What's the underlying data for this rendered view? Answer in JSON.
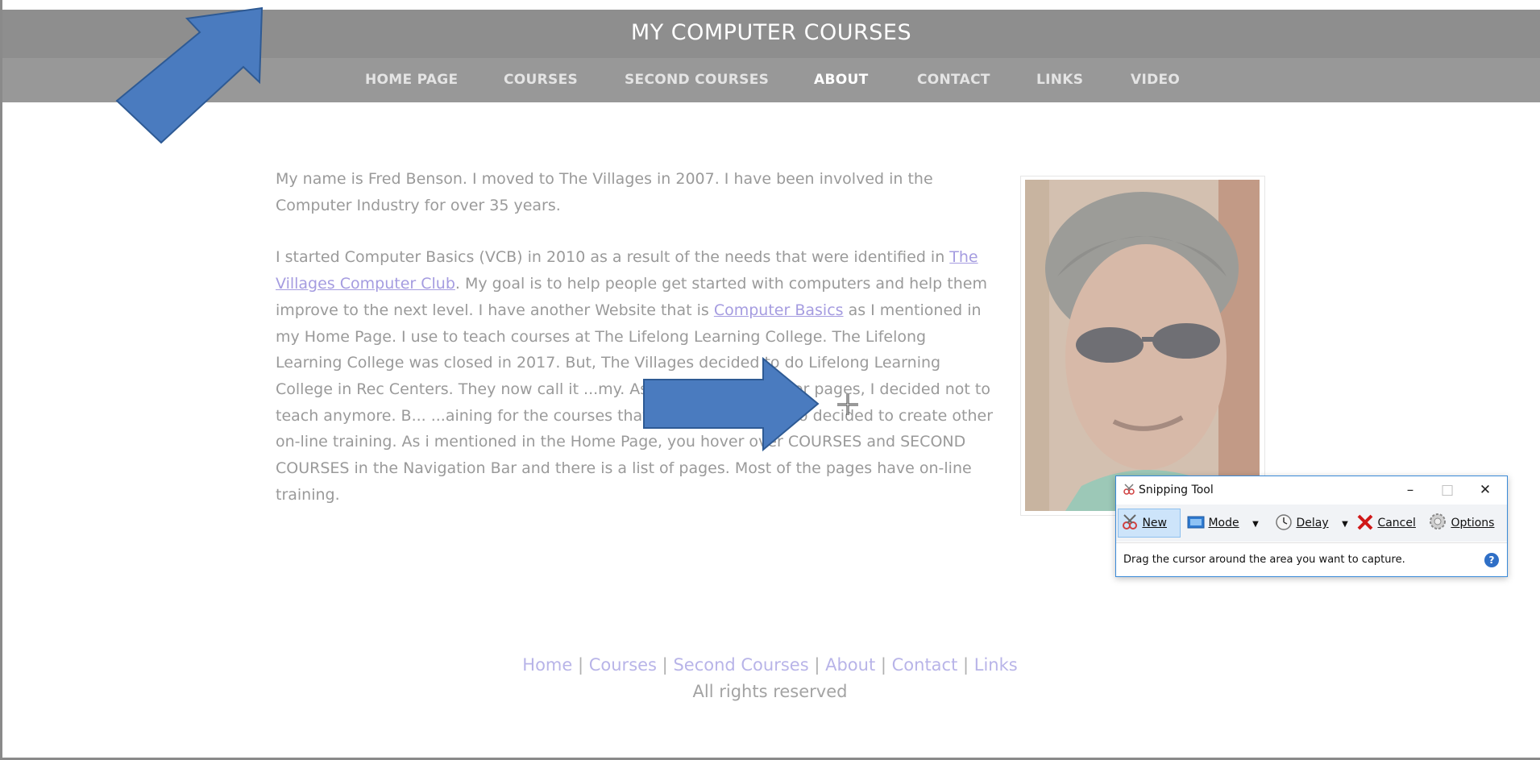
{
  "site": {
    "title": "MY COMPUTER COURSES"
  },
  "nav": {
    "items": [
      {
        "label": "HOME PAGE"
      },
      {
        "label": "COURSES"
      },
      {
        "label": "SECOND COURSES"
      },
      {
        "label": "ABOUT"
      },
      {
        "label": "CONTACT"
      },
      {
        "label": "LINKS"
      },
      {
        "label": "VIDEO"
      }
    ]
  },
  "bio": {
    "p1": "My name is Fred Benson.  I moved to The Villages in 2007.  I have been involved in the Computer Industry for over 35 years.",
    "p2_a": "I started Computer Basics (VCB) in 2010 as a result of the needs that were identified in ",
    "p2_link1": "The Villages Computer Club",
    "p2_b": ".  My goal is to help people get started with computers and help them improve to the next level.  I have another Website that is ",
    "p2_link2": "Computer Basics",
    "p2_c": " as I mentioned in my Home Page.  I use to teach courses at The Lifelong Learning College.  The Lifelong Learning College was closed in 2017.  But, The Villages decided to do Lifelong Learning College in Rec Centers.  They now call it ...my.  As I mentioned in other pages, I decided not to teach anymore.  B... ...aining for the courses that I use to teach.  I also decided to create other on-line training.  As i mentioned in the Home Page, you hover over COURSES and SECOND COURSES in the Navigation Bar and there is a list of pages.  Most of the pages have on-line training."
  },
  "footer": {
    "links": [
      "Home",
      "Courses",
      "Second Courses",
      "About",
      "Contact",
      "Links"
    ],
    "rights": "All rights reserved"
  },
  "snipping_tool": {
    "title": "Snipping Tool",
    "minimize": "–",
    "maximize": "□",
    "close": "✕",
    "new": "New",
    "mode": "Mode",
    "delay": "Delay",
    "cancel": "Cancel",
    "options": "Options",
    "status": "Drag the cursor around the area you want to capture.",
    "help": "?"
  },
  "colors": {
    "header": "#8e8e8e",
    "navbar": "#989898",
    "link": "#a59ce0",
    "annotation_arrow": "#4a7bbf"
  },
  "icons": [
    "scissors-icon",
    "mode-icon",
    "clock-icon",
    "cancel-x-icon",
    "options-gear-icon",
    "help-icon",
    "crosshair-cursor-icon"
  ]
}
